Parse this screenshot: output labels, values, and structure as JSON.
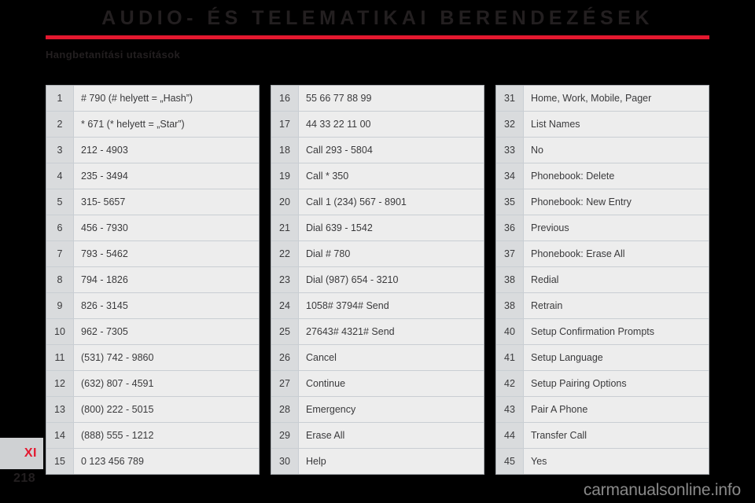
{
  "header": {
    "title": "AUDIO- ÉS TELEMATIKAI BERENDEZÉSEK",
    "subtitle": "Hangbetanítási utasítások",
    "rule_color": "#e3182f"
  },
  "footer": {
    "chapter_tab": "XI",
    "page_number": "218",
    "watermark": "carmanualsonline.info"
  },
  "tables": [
    {
      "id": "voice-commands-column-1",
      "rows": [
        {
          "index": "1",
          "value": "# 790 (# helyett = „Hash”)"
        },
        {
          "index": "2",
          "value": "* 671 (* helyett = „Star”)"
        },
        {
          "index": "3",
          "value": "212 - 4903"
        },
        {
          "index": "4",
          "value": "235 - 3494"
        },
        {
          "index": "5",
          "value": "315- 5657"
        },
        {
          "index": "6",
          "value": "456 - 7930"
        },
        {
          "index": "7",
          "value": "793 - 5462"
        },
        {
          "index": "8",
          "value": "794 - 1826"
        },
        {
          "index": "9",
          "value": "826 - 3145"
        },
        {
          "index": "10",
          "value": "962 - 7305"
        },
        {
          "index": "11",
          "value": "(531) 742 - 9860"
        },
        {
          "index": "12",
          "value": "(632) 807 - 4591"
        },
        {
          "index": "13",
          "value": "(800) 222 - 5015"
        },
        {
          "index": "14",
          "value": "(888) 555 - 1212"
        },
        {
          "index": "15",
          "value": "0 123 456 789"
        }
      ]
    },
    {
      "id": "voice-commands-column-2",
      "rows": [
        {
          "index": "16",
          "value": "55 66 77 88 99"
        },
        {
          "index": "17",
          "value": "44 33 22 11 00"
        },
        {
          "index": "18",
          "value": "Call 293 - 5804"
        },
        {
          "index": "19",
          "value": "Call * 350"
        },
        {
          "index": "20",
          "value": "Call 1 (234) 567 - 8901"
        },
        {
          "index": "21",
          "value": "Dial 639 - 1542"
        },
        {
          "index": "22",
          "value": "Dial # 780"
        },
        {
          "index": "23",
          "value": "Dial (987) 654 - 3210"
        },
        {
          "index": "24",
          "value": "1058# 3794# Send"
        },
        {
          "index": "25",
          "value": "27643# 4321# Send"
        },
        {
          "index": "26",
          "value": "Cancel"
        },
        {
          "index": "27",
          "value": "Continue"
        },
        {
          "index": "28",
          "value": "Emergency"
        },
        {
          "index": "29",
          "value": "Erase All"
        },
        {
          "index": "30",
          "value": "Help"
        }
      ]
    },
    {
      "id": "voice-commands-column-3",
      "rows": [
        {
          "index": "31",
          "value": "Home, Work, Mobile, Pager"
        },
        {
          "index": "32",
          "value": "List Names"
        },
        {
          "index": "33",
          "value": "No"
        },
        {
          "index": "34",
          "value": "Phonebook: Delete"
        },
        {
          "index": "35",
          "value": "Phonebook: New Entry"
        },
        {
          "index": "36",
          "value": "Previous"
        },
        {
          "index": "37",
          "value": "Phonebook: Erase All"
        },
        {
          "index": "38",
          "value": "Redial"
        },
        {
          "index": "38",
          "value": "Retrain"
        },
        {
          "index": "40",
          "value": "Setup Confirmation Prompts"
        },
        {
          "index": "41",
          "value": "Setup Language"
        },
        {
          "index": "42",
          "value": "Setup Pairing Options"
        },
        {
          "index": "43",
          "value": "Pair A Phone"
        },
        {
          "index": "44",
          "value": "Transfer Call"
        },
        {
          "index": "45",
          "value": "Yes"
        }
      ]
    }
  ]
}
